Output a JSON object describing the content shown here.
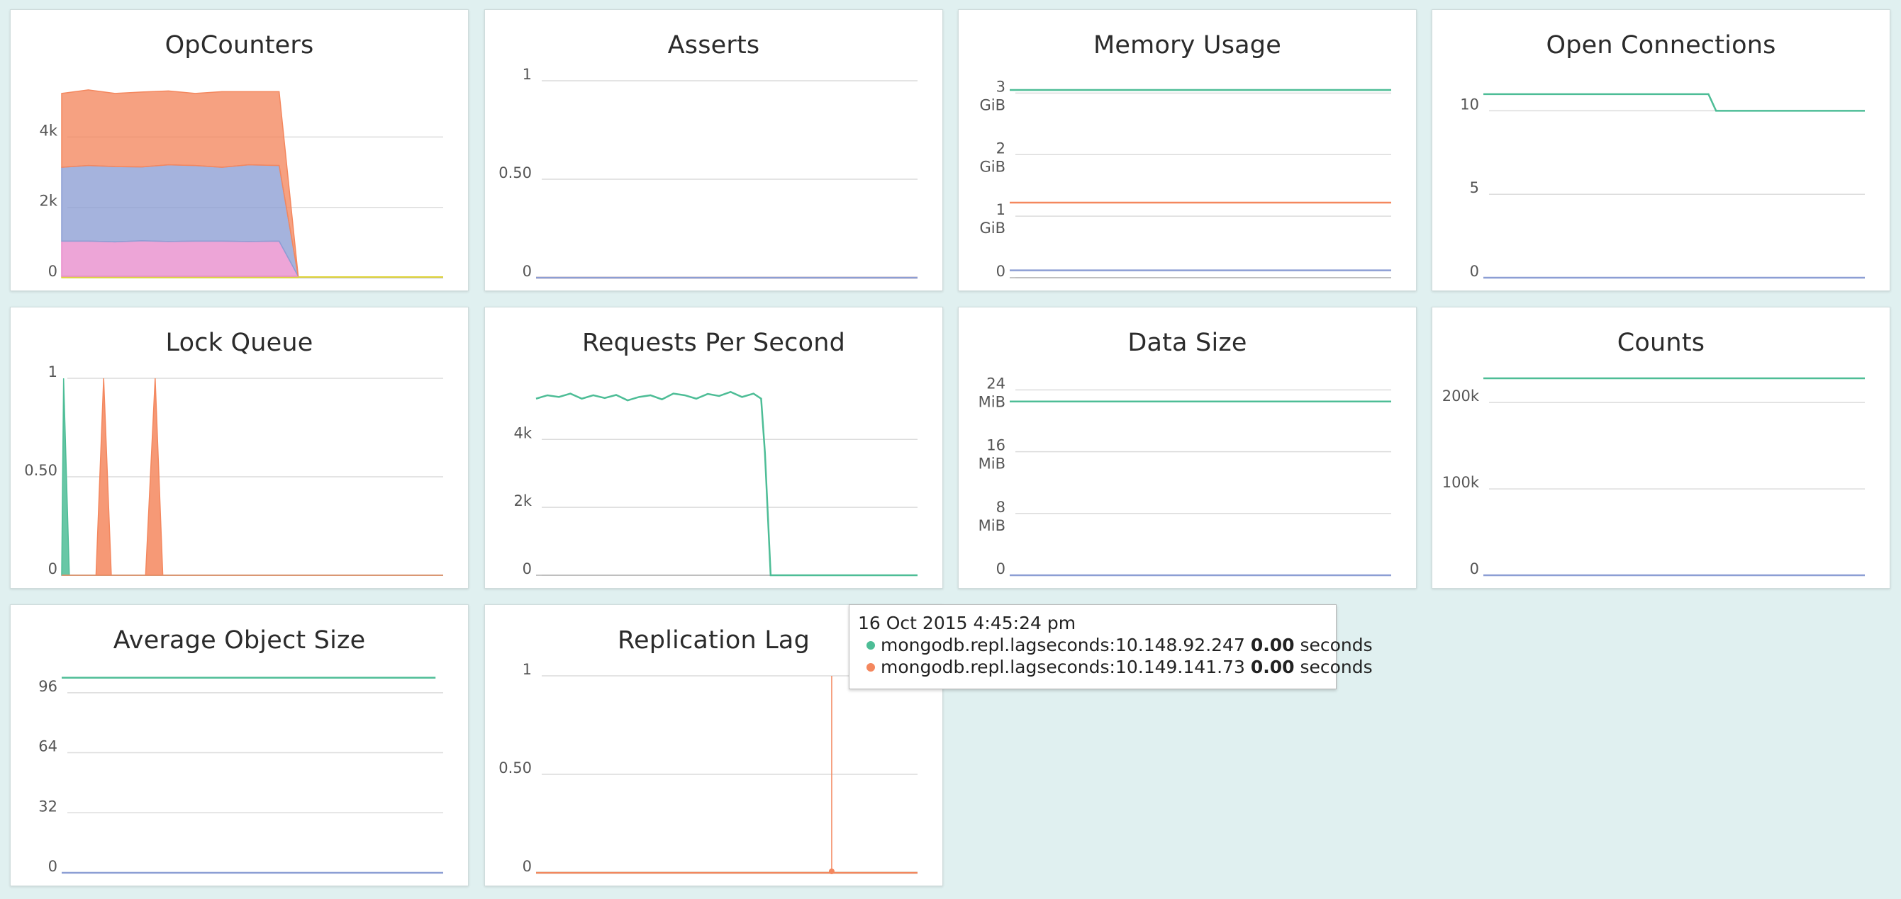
{
  "colors": {
    "teal": "#4dbd96",
    "orange": "#f4875e",
    "blue": "#8c9ed4",
    "pink": "#e88ccc",
    "yellow": "#e0d43a",
    "grid": "#dcdcdc",
    "axis_text": "#555555"
  },
  "panels": [
    {
      "id": "opcounters",
      "title": "OpCounters",
      "chart_data": {
        "type": "area",
        "stacked": true,
        "ylim": [
          0,
          5600
        ],
        "yticks": [
          {
            "v": 0,
            "label": "0"
          },
          {
            "v": 2000,
            "label": "2k"
          },
          {
            "v": 4000,
            "label": "4k"
          }
        ],
        "x": [
          0,
          0.07,
          0.14,
          0.21,
          0.28,
          0.35,
          0.42,
          0.49,
          0.56,
          0.62,
          0.6,
          0.62
        ],
        "series": [
          {
            "color": "yellow",
            "values": [
              40,
              40,
              40,
              40,
              40,
              40,
              40,
              40,
              40,
              40
            ]
          },
          {
            "color": "pink",
            "values": [
              1000,
              1000,
              980,
              1010,
              990,
              1000,
              1000,
              990,
              1000,
              0
            ]
          },
          {
            "color": "blue",
            "values": [
              2100,
              2150,
              2140,
              2100,
              2180,
              2150,
              2100,
              2180,
              2150,
              0
            ]
          },
          {
            "color": "orange",
            "values": [
              2100,
              2150,
              2080,
              2130,
              2100,
              2050,
              2150,
              2080,
              2100,
              0
            ]
          }
        ],
        "xpos": [
          0,
          0.07,
          0.14,
          0.21,
          0.28,
          0.35,
          0.42,
          0.49,
          0.57,
          0.62
        ]
      }
    },
    {
      "id": "asserts",
      "title": "Asserts",
      "chart_data": {
        "type": "line",
        "ylim": [
          0,
          1
        ],
        "yticks": [
          {
            "v": 0,
            "label": "0"
          },
          {
            "v": 0.5,
            "label": "0.50"
          },
          {
            "v": 1,
            "label": "1"
          }
        ],
        "series": [
          {
            "color": "orange",
            "x": [
              0,
              1
            ],
            "y": [
              0,
              0
            ]
          },
          {
            "color": "blue",
            "x": [
              0,
              1
            ],
            "y": [
              0,
              0
            ]
          }
        ]
      }
    },
    {
      "id": "memory-usage",
      "title": "Memory Usage",
      "chart_data": {
        "type": "line",
        "ylim": [
          0,
          3.2
        ],
        "yticks": [
          {
            "v": 0,
            "label": "0"
          },
          {
            "v": 1,
            "label": "1",
            "unit": "GiB"
          },
          {
            "v": 2,
            "label": "2",
            "unit": "GiB"
          },
          {
            "v": 3,
            "label": "3",
            "unit": "GiB"
          }
        ],
        "series": [
          {
            "color": "teal",
            "x": [
              0,
              1
            ],
            "y": [
              3.05,
              3.05
            ]
          },
          {
            "color": "orange",
            "x": [
              0,
              1
            ],
            "y": [
              1.22,
              1.22
            ]
          },
          {
            "color": "blue",
            "x": [
              0,
              1
            ],
            "y": [
              0.12,
              0.12
            ]
          }
        ]
      }
    },
    {
      "id": "open-connections",
      "title": "Open Connections",
      "chart_data": {
        "type": "line",
        "ylim": [
          0,
          11.8
        ],
        "yticks": [
          {
            "v": 0,
            "label": "0"
          },
          {
            "v": 5,
            "label": "5"
          },
          {
            "v": 10,
            "label": "10"
          }
        ],
        "series": [
          {
            "color": "teal",
            "x": [
              0,
              0.59,
              0.61,
              1
            ],
            "y": [
              11,
              11,
              10,
              10
            ]
          },
          {
            "color": "blue",
            "x": [
              0,
              1
            ],
            "y": [
              0,
              0
            ]
          }
        ]
      }
    },
    {
      "id": "lock-queue",
      "title": "Lock Queue",
      "chart_data": {
        "type": "area",
        "ylim": [
          0,
          1
        ],
        "yticks": [
          {
            "v": 0,
            "label": "0"
          },
          {
            "v": 0.5,
            "label": "0.50"
          },
          {
            "v": 1,
            "label": "1"
          }
        ],
        "series": [
          {
            "color": "teal",
            "x": [
              0,
              0.005,
              0.02,
              1
            ],
            "y": [
              0,
              1,
              0,
              0
            ]
          },
          {
            "color": "orange",
            "x": [
              0,
              0.09,
              0.11,
              0.13,
              0.22,
              0.245,
              0.265,
              1
            ],
            "y": [
              0,
              0,
              1,
              0,
              0,
              1,
              0,
              0
            ]
          }
        ]
      }
    },
    {
      "id": "requests-per-second",
      "title": "Requests Per Second",
      "chart_data": {
        "type": "line",
        "ylim": [
          0,
          5800
        ],
        "yticks": [
          {
            "v": 0,
            "label": "0"
          },
          {
            "v": 2000,
            "label": "2k"
          },
          {
            "v": 4000,
            "label": "4k"
          }
        ],
        "series": [
          {
            "color": "teal",
            "x": [
              0,
              0.03,
              0.06,
              0.09,
              0.12,
              0.15,
              0.18,
              0.21,
              0.24,
              0.27,
              0.3,
              0.33,
              0.36,
              0.39,
              0.42,
              0.45,
              0.48,
              0.51,
              0.54,
              0.57,
              0.59,
              0.6,
              0.615,
              1
            ],
            "y": [
              5200,
              5300,
              5250,
              5350,
              5200,
              5300,
              5220,
              5310,
              5150,
              5250,
              5300,
              5180,
              5350,
              5300,
              5200,
              5340,
              5280,
              5400,
              5250,
              5350,
              5200,
              3600,
              0,
              0
            ]
          }
        ]
      }
    },
    {
      "id": "data-size",
      "title": "Data Size",
      "chart_data": {
        "type": "line",
        "ylim": [
          0,
          25.5
        ],
        "yticks": [
          {
            "v": 0,
            "label": "0"
          },
          {
            "v": 8,
            "label": "8",
            "unit": "MiB"
          },
          {
            "v": 16,
            "label": "16",
            "unit": "MiB"
          },
          {
            "v": 24,
            "label": "24",
            "unit": "MiB"
          }
        ],
        "series": [
          {
            "color": "teal",
            "x": [
              0,
              1
            ],
            "y": [
              22.5,
              22.5
            ]
          },
          {
            "color": "blue",
            "x": [
              0,
              1
            ],
            "y": [
              0,
              0
            ]
          }
        ]
      }
    },
    {
      "id": "counts",
      "title": "Counts",
      "chart_data": {
        "type": "line",
        "ylim": [
          0,
          228000
        ],
        "yticks": [
          {
            "v": 0,
            "label": "0"
          },
          {
            "v": 100000,
            "label": "100k"
          },
          {
            "v": 200000,
            "label": "200k"
          }
        ],
        "series": [
          {
            "color": "teal",
            "x": [
              0,
              1
            ],
            "y": [
              228000,
              228000
            ]
          },
          {
            "color": "blue",
            "x": [
              0,
              1
            ],
            "y": [
              0,
              0
            ]
          }
        ]
      }
    },
    {
      "id": "average-object-size",
      "title": "Average Object Size",
      "chart_data": {
        "type": "line",
        "ylim": [
          0,
          105
        ],
        "yticks": [
          {
            "v": 0,
            "label": "0"
          },
          {
            "v": 32,
            "label": "32"
          },
          {
            "v": 64,
            "label": "64"
          },
          {
            "v": 96,
            "label": "96"
          }
        ],
        "series": [
          {
            "color": "teal",
            "x": [
              0,
              0.98
            ],
            "y": [
              104,
              104
            ]
          },
          {
            "color": "blue",
            "x": [
              0,
              1
            ],
            "y": [
              0,
              0
            ]
          }
        ]
      }
    },
    {
      "id": "replication-lag",
      "title": "Replication Lag",
      "chart_data": {
        "type": "line",
        "ylim": [
          0,
          1
        ],
        "yticks": [
          {
            "v": 0,
            "label": "0"
          },
          {
            "v": 0.5,
            "label": "0.50"
          },
          {
            "v": 1,
            "label": "1"
          }
        ],
        "series": [
          {
            "color": "teal",
            "x": [
              0,
              1
            ],
            "y": [
              0,
              0
            ]
          },
          {
            "color": "orange",
            "x": [
              0,
              1
            ],
            "y": [
              0,
              0
            ]
          }
        ]
      }
    }
  ],
  "tooltip": {
    "time": "16 Oct 2015 4:45:24 pm",
    "rows": [
      {
        "color": "teal",
        "label": "mongodb.repl.lagseconds:10.148.92.247",
        "value": "0.00",
        "unit": "seconds"
      },
      {
        "color": "orange",
        "label": "mongodb.repl.lagseconds:10.149.141.73",
        "value": "0.00",
        "unit": "seconds"
      }
    ]
  }
}
